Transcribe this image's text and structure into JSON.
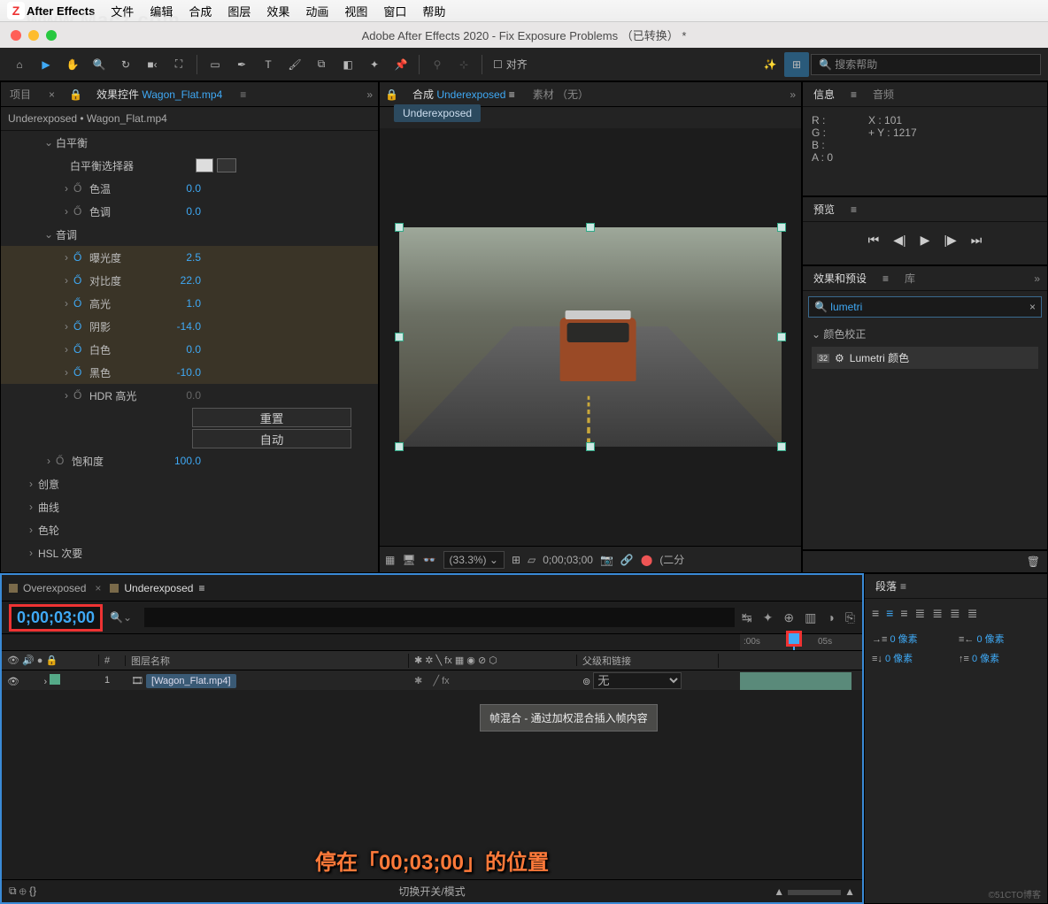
{
  "menubar": {
    "app": "After Effects",
    "items": [
      "文件",
      "编辑",
      "合成",
      "图层",
      "效果",
      "动画",
      "视图",
      "窗口",
      "帮助"
    ]
  },
  "titlebar": "Adobe After Effects 2020 - Fix Exposure Problems （已转换） *",
  "toolbar": {
    "snap": "对齐",
    "search_placeholder": "搜索帮助"
  },
  "watermark": "www.Macz.com",
  "panels": {
    "project_tab": "项目",
    "effect_controls_tab": "效果控件",
    "effect_controls_target": "Wagon_Flat.mp4",
    "breadcrumb": "Underexposed • Wagon_Flat.mp4",
    "comp_tab_prefix": "合成",
    "comp_name": "Underexposed",
    "footage_tab": "素材 （无）",
    "info": "信息",
    "audio": "音频",
    "preview": "预览",
    "effects_presets": "效果和预设",
    "library": "库",
    "paragraph": "段落"
  },
  "props": {
    "white_balance": "白平衡",
    "wb_selector": "白平衡选择器",
    "temp": "色温",
    "temp_v": "0.0",
    "tint": "色调",
    "tint_v": "0.0",
    "tone": "音调",
    "exposure": "曝光度",
    "exposure_v": "2.5",
    "contrast": "对比度",
    "contrast_v": "22.0",
    "highlights": "高光",
    "highlights_v": "1.0",
    "shadows": "阴影",
    "shadows_v": "-14.0",
    "whites": "白色",
    "whites_v": "0.0",
    "blacks": "黑色",
    "blacks_v": "-10.0",
    "hdr": "HDR 高光",
    "hdr_v": "0.0",
    "reset": "重置",
    "auto": "自动",
    "saturation": "饱和度",
    "saturation_v": "100.0",
    "creative": "创意",
    "curves": "曲线",
    "colorwheel": "色轮",
    "hsl": "HSL 次要"
  },
  "viewer": {
    "zoom": "(33.3%)",
    "timecode": "0;00;03;00",
    "res": "(二分"
  },
  "info": {
    "r": "R :",
    "g": "G :",
    "b": "B :",
    "a": "A : 0",
    "x": "X : 101",
    "y": "Y : 1217"
  },
  "effects_search": "lumetri",
  "effects_cat": "颜色校正",
  "effects_item": "Lumetri 颜色",
  "timeline": {
    "tab1": "Overexposed",
    "tab2": "Underexposed",
    "timecode": "0;00;03;00",
    "col_num": "#",
    "col_name": "图层名称",
    "col_parent": "父级和链接",
    "layer_num": "1",
    "layer_name": "[Wagon_Flat.mp4]",
    "parent_none": "无",
    "ruler_0": ":00s",
    "ruler_5": "05s",
    "tooltip": "帧混合 - 通过加权混合插入帧内容",
    "footer": "切换开关/模式"
  },
  "paragraph": {
    "px": "0 像素"
  },
  "caption": "停在「00;03;00」的位置",
  "footer": "©51CTO博客"
}
